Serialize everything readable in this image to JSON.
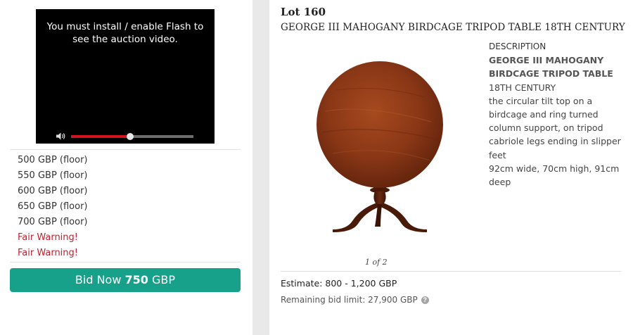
{
  "video": {
    "message": "You must install / enable Flash to see the auction video.",
    "progress": 0.48
  },
  "bids": [
    {
      "text": "500 GBP (floor)",
      "type": "bid"
    },
    {
      "text": "550 GBP (floor)",
      "type": "bid"
    },
    {
      "text": "600 GBP (floor)",
      "type": "bid"
    },
    {
      "text": "650 GBP (floor)",
      "type": "bid"
    },
    {
      "text": "700 GBP (floor)",
      "type": "bid"
    },
    {
      "text": "Fair Warning!",
      "type": "warning"
    },
    {
      "text": "Fair Warning!",
      "type": "warning"
    }
  ],
  "bid_button": {
    "prefix": "Bid Now",
    "amount": "750",
    "currency": "GBP"
  },
  "lot": {
    "number": "Lot 160",
    "title": "GEORGE III MAHOGANY BIRDCAGE TRIPOD TABLE 18TH CENTURY",
    "image_alt": "Mahogany birdcage tripod table",
    "pager": "1 of 2"
  },
  "description": {
    "heading": "DESCRIPTION",
    "title": "GEORGE III MAHOGANY BIRDCAGE TRIPOD TABLE",
    "century": "18TH CENTURY",
    "body": "the circular tilt top on a birdcage and ring turned column support, on tripod cabriole legs ending in slipper feet",
    "dimensions": "92cm wide, 70cm high, 91cm deep"
  },
  "estimate": "Estimate: 800 - 1,200 GBP",
  "remaining_limit": "Remaining bid limit: 27,900 GBP",
  "colors": {
    "bid_button": "#17a08a",
    "warning": "#c4202f",
    "progress": "#d4141c"
  }
}
